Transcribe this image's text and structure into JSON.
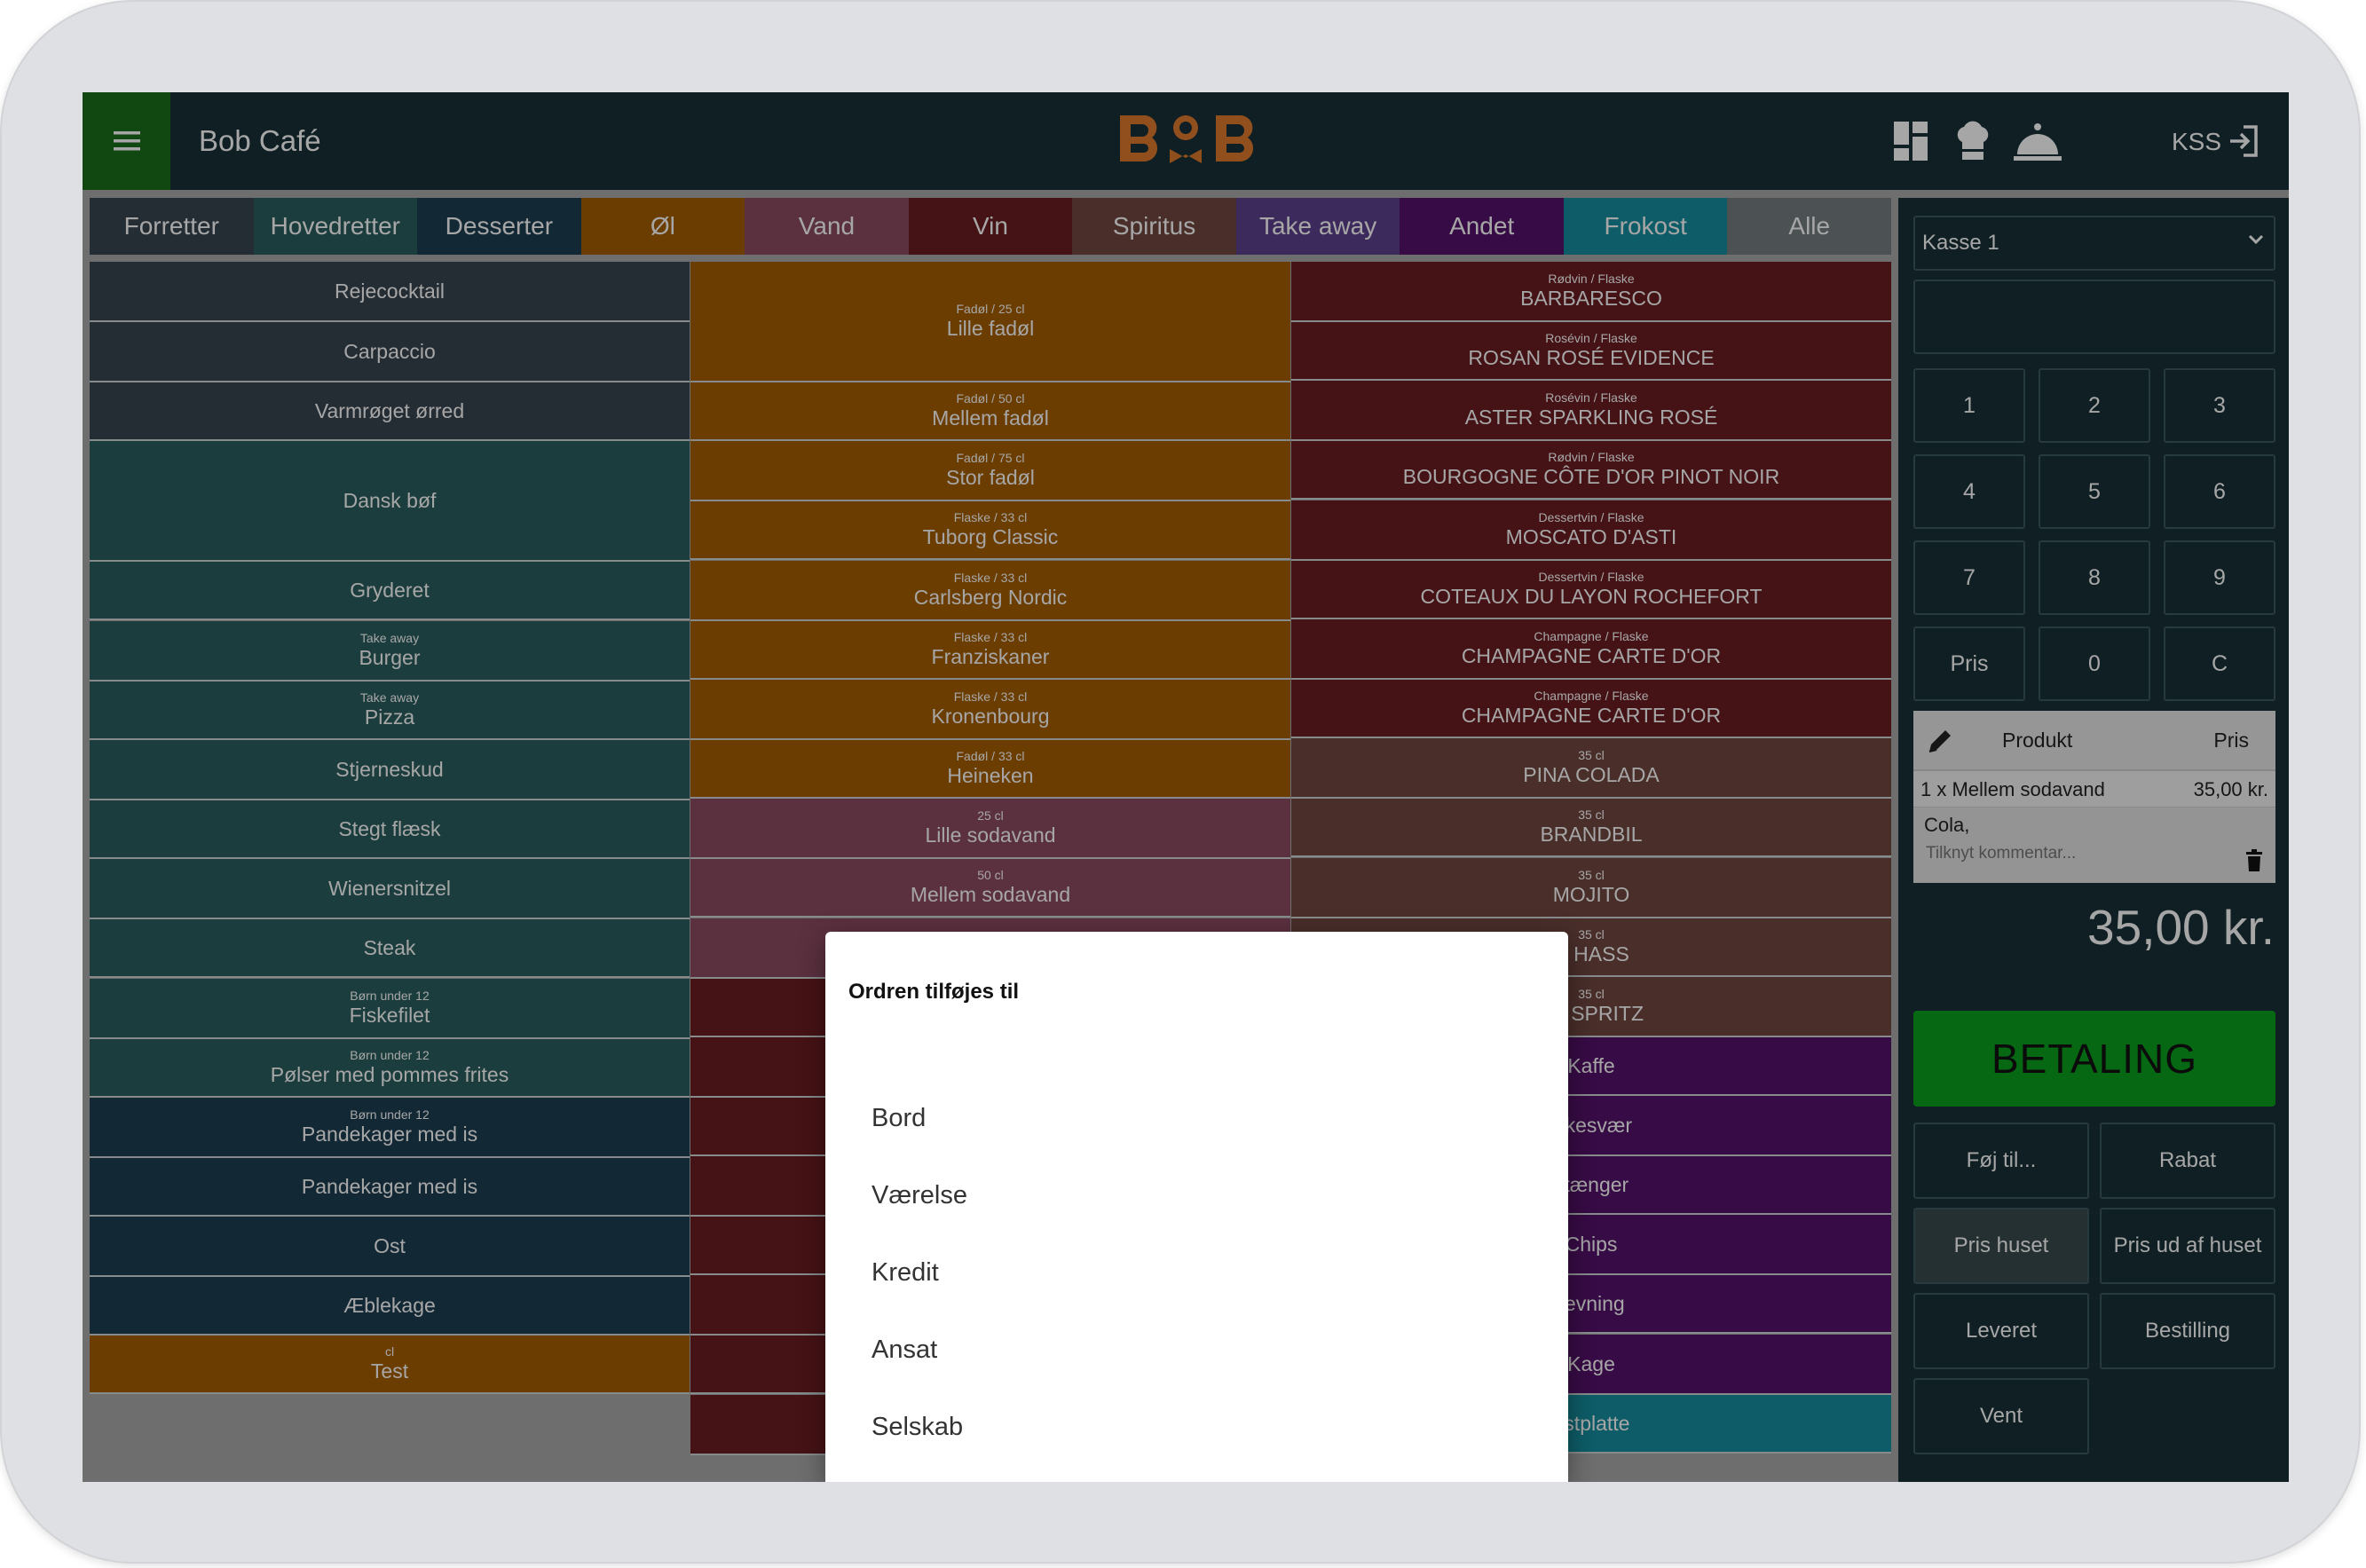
{
  "app": {
    "title": "Bob Café",
    "logo_text": "BOB",
    "user": "KSS"
  },
  "tabs": [
    {
      "label": "Forretter",
      "color": "#3a4550"
    },
    {
      "label": "Hovedretter",
      "color": "#2b5e5e"
    },
    {
      "label": "Desserter",
      "color": "#1e3e52"
    },
    {
      "label": "Øl",
      "color": "#a65f00"
    },
    {
      "label": "Vand",
      "color": "#8c4a62"
    },
    {
      "label": "Vin",
      "color": "#6b1c21"
    },
    {
      "label": "Spiritus",
      "color": "#704841"
    },
    {
      "label": "Take away",
      "color": "#5e4190"
    },
    {
      "label": "Andet",
      "color": "#55116b"
    },
    {
      "label": "Frokost",
      "color": "#148e9e"
    },
    {
      "label": "Alle",
      "color": "#767d80"
    }
  ],
  "products": {
    "col1": [
      {
        "sub": "",
        "name": "Rejecocktail",
        "color": "#3a4550"
      },
      {
        "sub": "",
        "name": "Carpaccio",
        "color": "#3a4550"
      },
      {
        "sub": "",
        "name": "Varmrøget ørred",
        "color": "#3a4550"
      },
      {
        "sub": "",
        "name": "Dansk bøf",
        "color": "#2b5e5e"
      },
      {
        "sub": "",
        "name": "Gryderet",
        "color": "#2b5e5e"
      },
      {
        "sub": "Take away",
        "name": "Burger",
        "color": "#2b5e5e"
      },
      {
        "sub": "Take away",
        "name": "Pizza",
        "color": "#2b5e5e"
      },
      {
        "sub": "",
        "name": "Stjerneskud",
        "color": "#2b5e5e"
      },
      {
        "sub": "",
        "name": "Stegt flæsk",
        "color": "#2b5e5e"
      },
      {
        "sub": "",
        "name": "Wienersnitzel",
        "color": "#2b5e5e"
      },
      {
        "sub": "",
        "name": "Steak",
        "color": "#2b5e5e"
      },
      {
        "sub": "Børn under 12",
        "name": "Fiskefilet",
        "color": "#2b5e5e"
      },
      {
        "sub": "Børn under 12",
        "name": "Pølser med pommes frites",
        "color": "#2b5e5e"
      },
      {
        "sub": "Børn under 12",
        "name": "Pandekager med is",
        "color": "#1e3e52"
      },
      {
        "sub": "",
        "name": "Pandekager med is",
        "color": "#1e3e52"
      },
      {
        "sub": "",
        "name": "Ost",
        "color": "#1e3e52"
      },
      {
        "sub": "",
        "name": "Æblekage",
        "color": "#1e3e52"
      },
      {
        "sub": "cl",
        "name": "Test",
        "color": "#a65f00"
      }
    ],
    "col2": [
      {
        "sub": "Fadøl / 25 cl",
        "name": "Lille fadøl",
        "color": "#a65f00"
      },
      {
        "sub": "Fadøl / 50 cl",
        "name": "Mellem fadøl",
        "color": "#a65f00"
      },
      {
        "sub": "Fadøl / 75 cl",
        "name": "Stor fadøl",
        "color": "#a65f00"
      },
      {
        "sub": "Flaske / 33 cl",
        "name": "Tuborg Classic",
        "color": "#a65f00"
      },
      {
        "sub": "Flaske / 33 cl",
        "name": "Carlsberg Nordic",
        "color": "#a65f00"
      },
      {
        "sub": "Flaske / 33 cl",
        "name": "Franziskaner",
        "color": "#a65f00"
      },
      {
        "sub": "Flaske / 33 cl",
        "name": "Kronenbourg",
        "color": "#a65f00"
      },
      {
        "sub": "Fadøl / 33 cl",
        "name": "Heineken",
        "color": "#a65f00"
      },
      {
        "sub": "25 cl",
        "name": "Lille sodavand",
        "color": "#8c4a62"
      },
      {
        "sub": "50 cl",
        "name": "Mellem sodavand",
        "color": "#8c4a62"
      },
      {
        "sub": "",
        "name": "",
        "color": "#8c4a62"
      },
      {
        "sub": "",
        "name": "",
        "color": "#6b1c21"
      },
      {
        "sub": "",
        "name": "",
        "color": "#6b1c21"
      },
      {
        "sub": "",
        "name": "",
        "color": "#6b1c21"
      },
      {
        "sub": "",
        "name": "",
        "color": "#6b1c21"
      },
      {
        "sub": "",
        "name": "",
        "color": "#6b1c21"
      },
      {
        "sub": "",
        "name": "",
        "color": "#6b1c21"
      },
      {
        "sub": "",
        "name": "",
        "color": "#6b1c21"
      },
      {
        "sub": "",
        "name": "",
        "color": "#6b1c21"
      }
    ],
    "col3": [
      {
        "sub": "Rødvin / Flaske",
        "name": "BARBARESCO",
        "color": "#6b1c21"
      },
      {
        "sub": "Rosévin / Flaske",
        "name": "ROSAN ROSÉ EVIDENCE",
        "color": "#6b1c21"
      },
      {
        "sub": "Rosévin / Flaske",
        "name": "ASTER SPARKLING ROSÉ",
        "color": "#6b1c21"
      },
      {
        "sub": "Rødvin / Flaske",
        "name": "BOURGOGNE CÔTE D'OR PINOT NOIR",
        "color": "#6b1c21"
      },
      {
        "sub": "Dessertvin / Flaske",
        "name": "MOSCATO D'ASTI",
        "color": "#6b1c21"
      },
      {
        "sub": "Dessertvin / Flaske",
        "name": "COTEAUX DU LAYON ROCHEFORT",
        "color": "#6b1c21"
      },
      {
        "sub": "Champagne / Flaske",
        "name": "CHAMPAGNE CARTE D'OR",
        "color": "#6b1c21"
      },
      {
        "sub": "Champagne / Flaske",
        "name": "CHAMPAGNE CARTE D'OR",
        "color": "#6b1c21"
      },
      {
        "sub": "35 cl",
        "name": "PINA COLADA",
        "color": "#704841"
      },
      {
        "sub": "35 cl",
        "name": "BRANDBIL",
        "color": "#704841"
      },
      {
        "sub": "35 cl",
        "name": "MOJITO",
        "color": "#704841"
      },
      {
        "sub": "35 cl",
        "name": "N HASS",
        "color": "#704841"
      },
      {
        "sub": "35 cl",
        "name": "OL SPRITZ",
        "color": "#704841"
      },
      {
        "sub": "",
        "name": "Kaffe",
        "color": "#55116b"
      },
      {
        "sub": "",
        "name": "iskesvær",
        "color": "#55116b"
      },
      {
        "sub": "",
        "name": "stænger",
        "color": "#55116b"
      },
      {
        "sub": "",
        "name": "Chips",
        "color": "#55116b"
      },
      {
        "sub": "",
        "name": "ævning",
        "color": "#55116b"
      },
      {
        "sub": "",
        "name": "Kage",
        "color": "#55116b"
      },
      {
        "sub": "",
        "name": "ostplatte",
        "color": "#148e9e"
      }
    ]
  },
  "register": {
    "selected": "Kasse 1",
    "keys": [
      "1",
      "2",
      "3",
      "4",
      "5",
      "6",
      "7",
      "8",
      "9",
      "Pris",
      "0",
      "C"
    ],
    "order": {
      "col_product": "Produkt",
      "col_price": "Pris",
      "line_item": "1 x Mellem sodavand",
      "line_price": "35,00 kr.",
      "comment": "Cola,",
      "comment_placeholder": "Tilknyt kommentar..."
    },
    "total": "35,00 kr.",
    "pay_label": "BETALING",
    "actions": [
      "Føj til...",
      "Rabat",
      "Pris huset",
      "Pris ud af huset",
      "Leveret",
      "Bestilling",
      "Vent"
    ]
  },
  "dialog": {
    "title": "Ordren tilføjes til",
    "options": [
      "Bord",
      "Værelse",
      "Kredit",
      "Ansat",
      "Selskab"
    ]
  },
  "colors": {
    "topbar": "#173137",
    "menu_button": "#1b6e1b",
    "logo": "#e07a2e",
    "pay_button": "#0aa01d"
  }
}
